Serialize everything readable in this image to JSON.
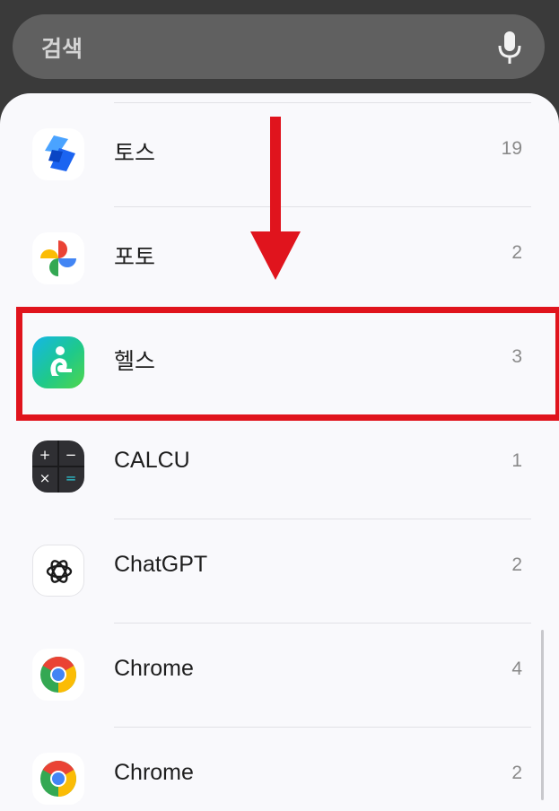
{
  "search": {
    "placeholder": "검색",
    "mic_icon": "microphone-icon"
  },
  "apps": [
    {
      "label": "토스",
      "count": "19",
      "icon": "toss-app-icon"
    },
    {
      "label": "포토",
      "count": "2",
      "icon": "google-photos-app-icon"
    },
    {
      "label": "헬스",
      "count": "3",
      "icon": "samsung-health-app-icon"
    },
    {
      "label": "CALCU",
      "count": "1",
      "icon": "calculator-app-icon"
    },
    {
      "label": "ChatGPT",
      "count": "2",
      "icon": "chatgpt-app-icon"
    },
    {
      "label": "Chrome",
      "count": "4",
      "icon": "chrome-app-icon"
    },
    {
      "label": "Chrome",
      "count": "2",
      "icon": "chrome-app-icon"
    }
  ],
  "annotation": {
    "arrow_color": "#e0141d",
    "highlight_color": "#e0141d",
    "highlighted_item": "헬스"
  }
}
